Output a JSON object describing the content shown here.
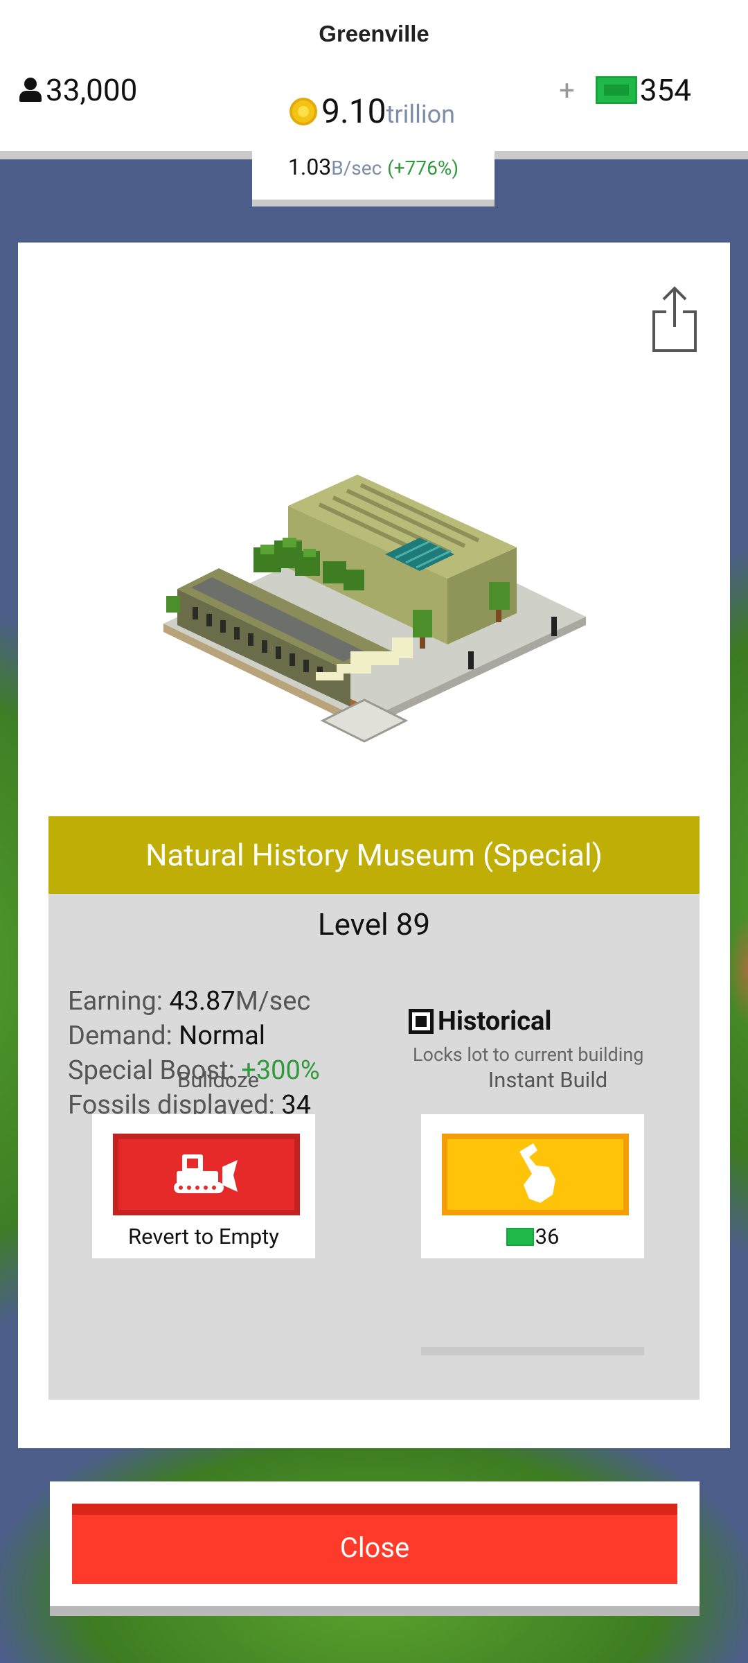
{
  "header": {
    "city_name": "Greenville",
    "population": "33,000",
    "coins_value": "9.10",
    "coins_unit": "trillion",
    "bucks_plus": "+",
    "bucks": "354",
    "rate_value": "1.03",
    "rate_unit": "B/sec",
    "rate_pct": "(+776%)"
  },
  "building": {
    "name": "Natural History Museum (Special)",
    "level": "Level 89",
    "stats": {
      "earning_label": "Earning: ",
      "earning_value": "43.87",
      "earning_unit": "M/sec",
      "demand_label": "Demand: ",
      "demand_value": "Normal",
      "boost_label": "Special Boost: ",
      "boost_value": "+300%",
      "fossils_label": "Fossils displayed: ",
      "fossils_value": "34"
    },
    "historical": {
      "label": "Historical",
      "checked": true,
      "description": "Locks lot to current building"
    }
  },
  "actions": {
    "bulldoze": {
      "title": "Bulldoze",
      "caption": "Revert to Empty"
    },
    "instant_build": {
      "title": "Instant Build",
      "cost": "36"
    }
  },
  "close_label": "Close",
  "colors": {
    "title_bar": "#bfae05",
    "close": "#fe3b2a",
    "bulldoze": "#e62a2a",
    "instant_build": "#ffc40a",
    "bucks": "#21b84a",
    "coin": "#f3c316"
  }
}
